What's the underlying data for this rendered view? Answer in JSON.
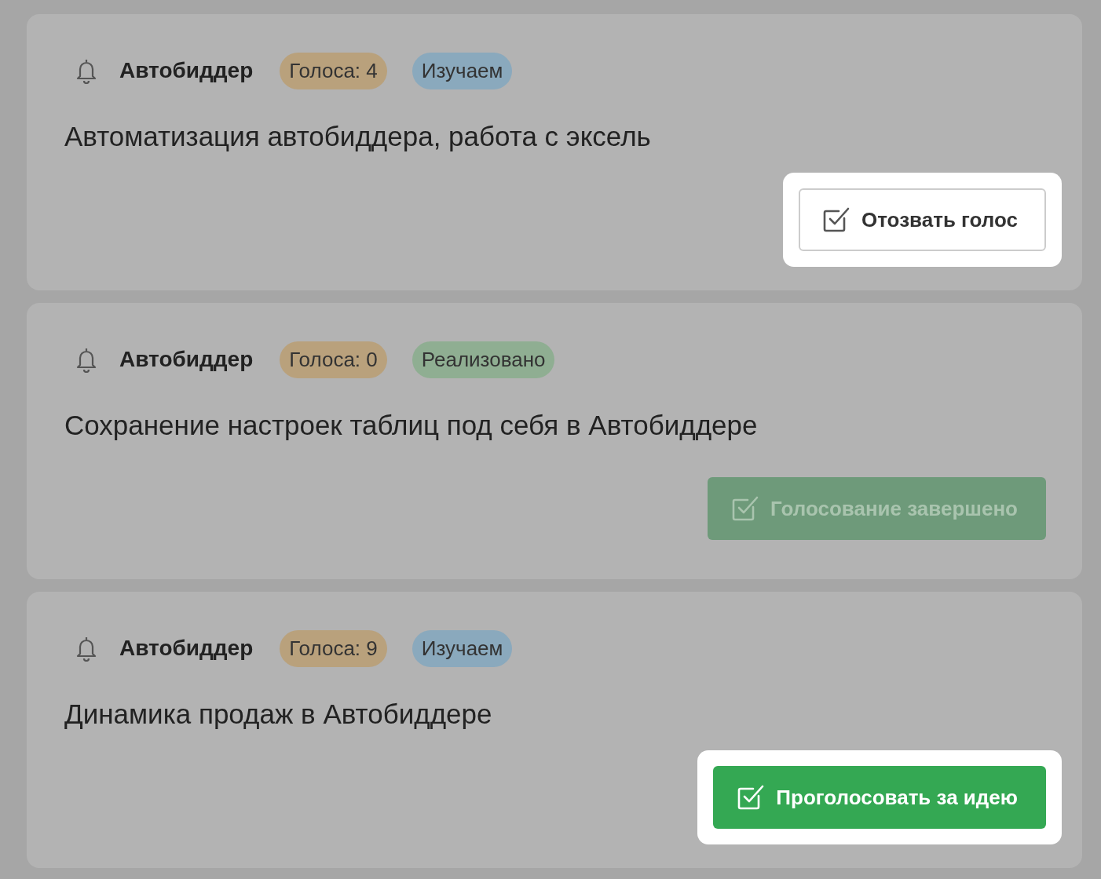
{
  "ideas": [
    {
      "category": "Автобиддер",
      "votes": "Голоса: 4",
      "status": {
        "label": "Изучаем",
        "color": "#8aa9bd"
      },
      "title": "Автоматизация автобиддера, работа с эксель",
      "action": {
        "label": "Отозвать голос",
        "kind": "outline",
        "disabled": false,
        "highlighted": true
      }
    },
    {
      "category": "Автобиддер",
      "votes": "Голоса: 0",
      "status": {
        "label": "Реализовано",
        "color": "#8fae92"
      },
      "title": "Сохранение настроек таблиц под себя в Автобиддере",
      "action": {
        "label": "Голосование завершено",
        "kind": "primary",
        "disabled": true,
        "highlighted": false
      }
    },
    {
      "category": "Автобиддер",
      "votes": "Голоса: 9",
      "status": {
        "label": "Изучаем",
        "color": "#8aa9bd"
      },
      "title": "Динамика продаж в Автобиддере",
      "action": {
        "label": "Проголосовать за идею",
        "kind": "primary",
        "disabled": false,
        "highlighted": true
      }
    }
  ]
}
